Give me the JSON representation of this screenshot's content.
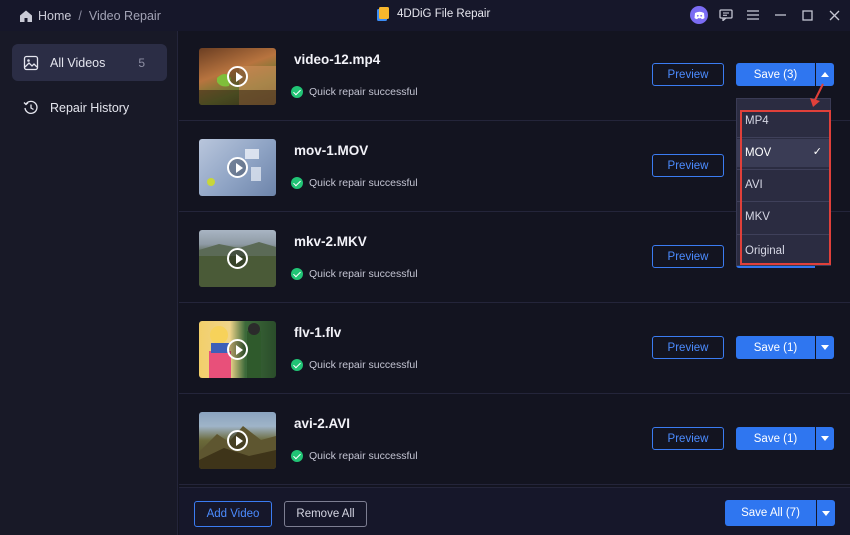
{
  "titlebar": {
    "home_label": "Home",
    "separator": "/",
    "current_page": "Video Repair",
    "app_title": "4DDiG File Repair",
    "icons": [
      "home-icon",
      "app-logo-icon",
      "discord-icon",
      "feedback-icon",
      "menu-icon",
      "minimize-icon",
      "maximize-icon",
      "close-icon"
    ]
  },
  "sidebar": {
    "items": [
      {
        "label": "All Videos",
        "count": "5",
        "icon": "image-icon",
        "active": true
      },
      {
        "label": "Repair History",
        "icon": "history-icon",
        "active": false
      }
    ]
  },
  "videos": [
    {
      "name": "video-12.mp4",
      "status": "Quick repair successful",
      "preview": "Preview",
      "save": "Save (3)",
      "menu_open": true
    },
    {
      "name": "mov-1.MOV",
      "status": "Quick repair successful",
      "preview": "Preview",
      "save": "",
      "menu_open": false
    },
    {
      "name": "mkv-2.MKV",
      "status": "Quick repair successful",
      "preview": "Preview",
      "save": "",
      "menu_open": false
    },
    {
      "name": "flv-1.flv",
      "status": "Quick repair successful",
      "preview": "Preview",
      "save": "Save (1)",
      "menu_open": false
    },
    {
      "name": "avi-2.AVI",
      "status": "Quick repair successful",
      "preview": "Preview",
      "save": "Save (1)",
      "menu_open": false
    }
  ],
  "format_menu": {
    "options": [
      "MP4",
      "MOV",
      "AVI",
      "MKV",
      "Original"
    ],
    "selected": "MOV",
    "tick": "✓"
  },
  "footer": {
    "add_video": "Add Video",
    "remove_all": "Remove All",
    "save_all": "Save All (7)"
  },
  "colors": {
    "accent": "#2f76f0",
    "success": "#21c475",
    "highlight": "#e0403a",
    "background": "#131420"
  }
}
